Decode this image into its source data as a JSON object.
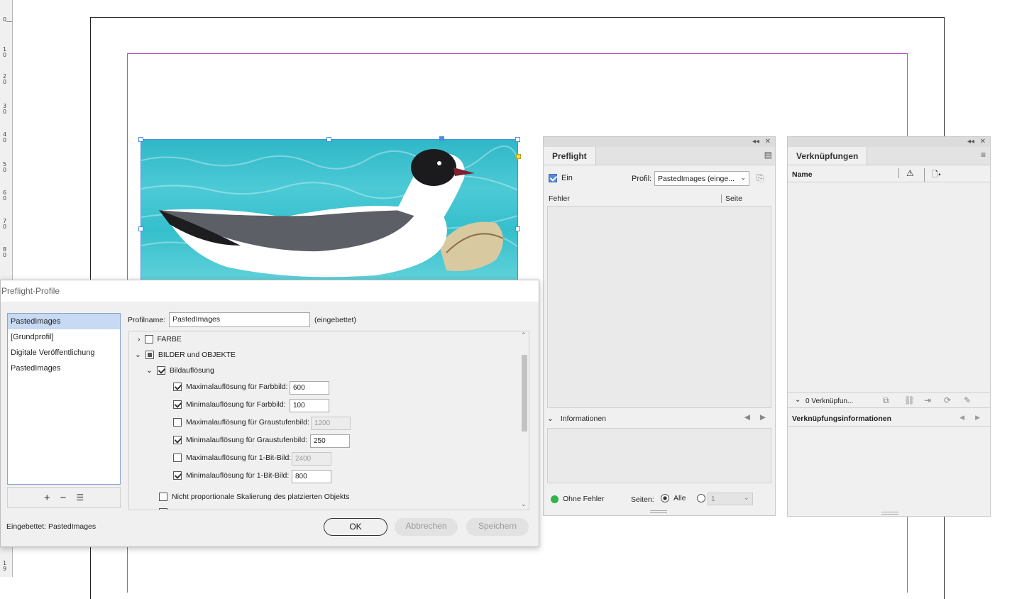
{
  "ruler": {
    "labels": [
      "0",
      "1\n0",
      "2\n0",
      "3\n0",
      "4\n0",
      "5\n0",
      "6\n0",
      "7\n0",
      "8\n0",
      "1\n9"
    ]
  },
  "preflight_panel": {
    "tab": "Preflight",
    "on_label": "Ein",
    "profile_label": "Profil:",
    "profile_value": "PastedImages (einge...",
    "col_errors": "Fehler",
    "col_page": "Seite",
    "info_label": "Informationen",
    "status": "Ohne Fehler",
    "pages_label": "Seiten:",
    "pages_all": "Alle",
    "pages_value": "1",
    "status_color": "#2fb34a"
  },
  "links_panel": {
    "tab": "Verknüpfungen",
    "col_name": "Name",
    "count": "0 Verknüpfun...",
    "info_label": "Verknüpfungsinformationen"
  },
  "dialog": {
    "title": "Preflight-Profile",
    "profiles": [
      "PastedImages",
      "[Grundprofil]",
      "Digitale Veröffentlichung",
      "PastedImages"
    ],
    "profile_name_label": "Profilname:",
    "profile_name_value": "PastedImages",
    "embedded_tag": "(eingebettet)",
    "tree": {
      "farbe": "FARBE",
      "bilder": "BILDER und OBJEKTE",
      "bildaufloesung": "Bildauflösung",
      "max_farb": "Maximalauflösung für Farbbild:",
      "max_farb_val": "600",
      "min_farb": "Minimalauflösung für Farbbild:",
      "min_farb_val": "100",
      "max_grau": "Maximalauflösung für Graustufenbild:",
      "max_grau_val": "1200",
      "min_grau": "Minimalauflösung für Graustufenbild:",
      "min_grau_val": "250",
      "max_1bit": "Maximalauflösung für 1-Bit-Bild:",
      "max_1bit_val": "2400",
      "min_1bit": "Minimalauflösung für 1-Bit-Bild:",
      "min_1bit_val": "800",
      "nonprop": "Nicht proportionale Skalierung des platzierten Objekts"
    },
    "list_buttons": {
      "add": "+",
      "remove": "−",
      "menu": "☰"
    },
    "embedded_label": "Eingebettet:",
    "embedded_value": "PastedImages",
    "ok": "OK",
    "cancel": "Abbrechen",
    "save": "Speichern"
  },
  "colors": {
    "margin_guide": "#b84cc9",
    "selection": "#4a8fe0",
    "dialog_bg": "#f0f0f0"
  }
}
